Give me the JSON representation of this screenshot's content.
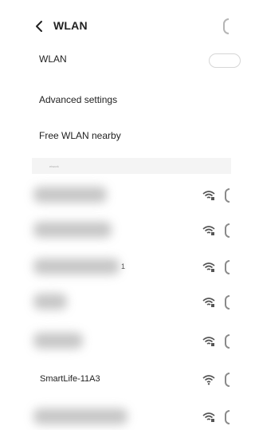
{
  "header": {
    "title": "WLAN"
  },
  "settings": {
    "wlan_label": "WLAN",
    "advanced_label": "Advanced settings",
    "free_wlan_label": "Free WLAN nearby"
  },
  "section": {
    "label": "etwork"
  },
  "networks": [
    {
      "name": "",
      "hidden": true,
      "icon": "wifi-secured-icon"
    },
    {
      "name": "",
      "hidden": true,
      "icon": "wifi-secured-icon"
    },
    {
      "name": "",
      "hidden": true,
      "suffix": "1",
      "icon": "wifi-secured-icon"
    },
    {
      "name": "",
      "hidden": true,
      "icon": "wifi-secured-icon"
    },
    {
      "name": "",
      "hidden": true,
      "icon": "wifi-secured-icon"
    },
    {
      "name": "SmartLife-11A3",
      "hidden": false,
      "icon": "wifi-open-icon"
    },
    {
      "name": "",
      "hidden": true,
      "icon": "wifi-secured-icon"
    }
  ],
  "colors": {
    "text": "#222222",
    "icon": "#555555",
    "divider_band": "#f4f4f4"
  }
}
